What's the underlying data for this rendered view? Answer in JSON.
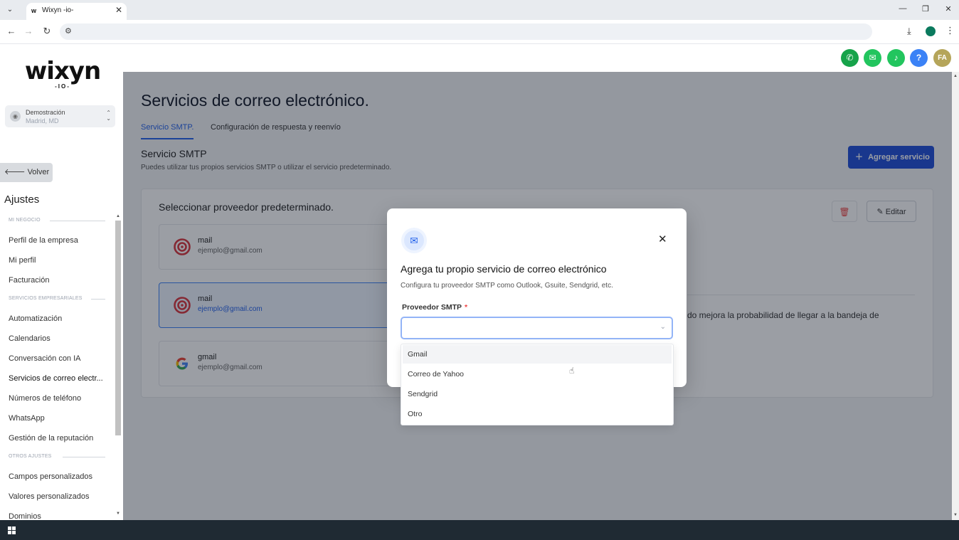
{
  "browser": {
    "tab_title": "Wixyn -io-",
    "tab_favicon": "wixyn",
    "colors": {
      "profile": "#0b7a5e"
    }
  },
  "header_icons": [
    {
      "name": "phone-icon",
      "glyph": "✆",
      "color": "#16a34a"
    },
    {
      "name": "megaphone-icon",
      "glyph": "📢",
      "color": "#22c55e"
    },
    {
      "name": "bell-icon",
      "glyph": "🔔",
      "color": "#22c55e"
    },
    {
      "name": "help-icon",
      "glyph": "?",
      "color": "#3b82f6"
    },
    {
      "name": "avatar",
      "glyph": "FA",
      "color": "#b5a55a"
    }
  ],
  "sidebar": {
    "logo_main": "wixyn",
    "logo_sub": "-IO-",
    "location_name": "Demostración",
    "location_city": "Madrid, MD",
    "back_label": "Volver",
    "settings_title": "Ajustes",
    "sections": [
      {
        "label": "MI NEGOCIO",
        "items": [
          "Perfil de la empresa",
          "Mi perfil",
          "Facturación"
        ]
      },
      {
        "label": "SERVICIOS EMPRESARIALES",
        "items": [
          "Automatización",
          "Calendarios",
          "Conversación con IA",
          "Servicios de correo electr...",
          "Números de teléfono",
          "WhatsApp",
          "Gestión de la reputación"
        ]
      },
      {
        "label": "OTROS AJUSTES",
        "items": [
          "Campos personalizados",
          "Valores personalizados",
          "Dominios"
        ]
      }
    ],
    "active_item": "Servicios de correo electr..."
  },
  "main": {
    "title": "Servicios de correo electrónico.",
    "tabs": [
      "Servicio SMTP.",
      "Configuración de respuesta y reenvío"
    ],
    "active_tab": "Servicio SMTP.",
    "section_title": "Servicio SMTP",
    "section_desc": "Puedes utilizar tus propios servicios SMTP o utilizar el servicio predeterminado.",
    "add_button": "Agregar servicio",
    "card_title": "Seleccionar proveedor predeterminado.",
    "edit_button": "Editar",
    "providers": [
      {
        "name": "mail",
        "email": "ejemplo@gmail.com",
        "icon": "target-icon",
        "selected": false
      },
      {
        "name": "mail",
        "email": "ejemplo@gmail.com",
        "icon": "target-icon",
        "selected": true
      },
      {
        "name": "gmail",
        "email": "ejemplo@gmail.com",
        "icon": "google-icon",
        "selected": false
      }
    ],
    "side_note": "do mejora la probabilidad de llegar a la bandeja de"
  },
  "modal": {
    "title": "Agrega tu propio servicio de correo electrónico",
    "description": "Configura tu proveedor SMTP como Outlook, Gsuite, Sendgrid, etc.",
    "field_label": "Proveedor SMTP",
    "required_mark": "*",
    "select_value": "",
    "options": [
      "Gmail",
      "Correo de Yahoo",
      "Sendgrid",
      "Otro"
    ],
    "hovered_option": "Gmail"
  }
}
